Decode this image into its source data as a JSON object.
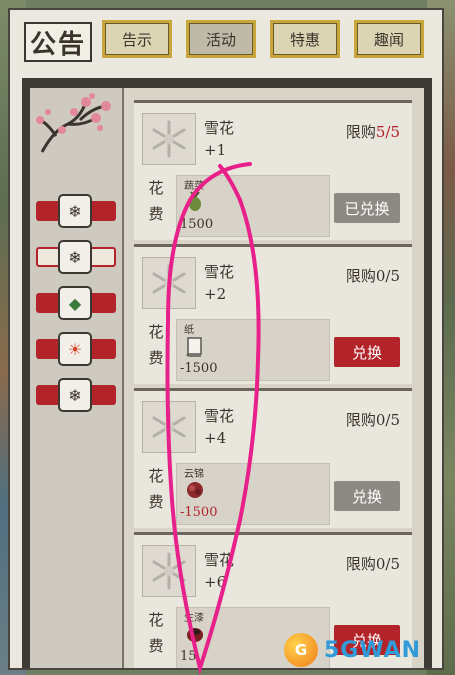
{
  "header": {
    "title": "公告",
    "tabs": [
      {
        "label": "告示",
        "active": false
      },
      {
        "label": "活动",
        "active": true
      },
      {
        "label": "特惠",
        "active": false
      },
      {
        "label": "趣闻",
        "active": false
      }
    ]
  },
  "sidebar": {
    "items": [
      {
        "icon": "snowflake-bag-icon",
        "glyph": "❄",
        "selected": false
      },
      {
        "icon": "snowflake-bag-icon",
        "glyph": "❄",
        "selected": true
      },
      {
        "icon": "gem-icon",
        "glyph": "◆",
        "selected": false
      },
      {
        "icon": "sun-swirl-icon",
        "glyph": "☀",
        "selected": false
      },
      {
        "icon": "snowflake-bag-icon",
        "glyph": "❄",
        "selected": false
      }
    ]
  },
  "shop": {
    "cost_label_1": "花",
    "cost_label_2": "费",
    "items": [
      {
        "name": "雪花",
        "amount": "+1",
        "limit_label": "限购",
        "limit_current": "5/5",
        "limit_full": true,
        "cost_item": "蔬菜",
        "cost_icon": "vegetable-icon",
        "price": "1500",
        "price_red": false,
        "button": "已兑换",
        "button_style": "gray"
      },
      {
        "name": "雪花",
        "amount": "+2",
        "limit_label": "限购",
        "limit_current": "0/5",
        "limit_full": false,
        "cost_item": "纸",
        "cost_icon": "paper-scroll-icon",
        "price": "-1500",
        "price_red": false,
        "button": "兑换",
        "button_style": "red"
      },
      {
        "name": "雪花",
        "amount": "+4",
        "limit_label": "限购",
        "limit_current": "0/5",
        "limit_full": false,
        "cost_item": "云锦",
        "cost_icon": "brocade-icon",
        "price": "-1500",
        "price_red": true,
        "button": "兑换",
        "button_style": "gray"
      },
      {
        "name": "雪花",
        "amount": "+6",
        "limit_label": "限购",
        "limit_current": "0/5",
        "limit_full": false,
        "cost_item": "生漆",
        "cost_icon": "lacquer-icon",
        "price": "15",
        "price_red": false,
        "button": "兑换",
        "button_style": "red"
      }
    ]
  },
  "watermark": {
    "badge": "G",
    "text": "5GWAN"
  },
  "colors": {
    "accent_red": "#b2242a",
    "tab_gold": "#c9a63a",
    "scribble": "#e8208a"
  }
}
